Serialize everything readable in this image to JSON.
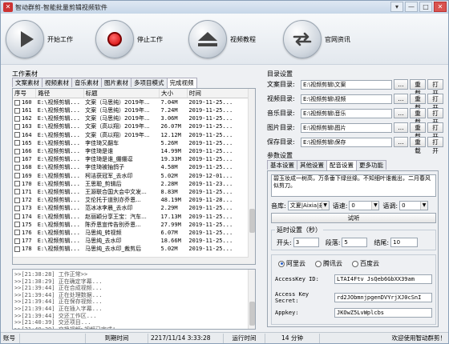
{
  "window": {
    "title": "智动群剪-智能批量剪辑视频软件",
    "controls": [
      "▾",
      "—",
      "□",
      "✕"
    ]
  },
  "toolbar": {
    "start_label": "开始工作",
    "stop_label": "停止工作",
    "tutorial_label": "视频教程",
    "website_label": "官网资讯"
  },
  "materials": {
    "section_title": "工作素材",
    "tabs": [
      "文案素材",
      "视频素材",
      "音乐素材",
      "图片素材",
      "多项目模式",
      "完成视频"
    ],
    "active_tab": 5,
    "columns": [
      "序号",
      "路径",
      "标题",
      "大小",
      "时间"
    ],
    "rows": [
      {
        "no": "160",
        "path": "E:\\视频剪辑...",
        "title": "文案（马思纯）2019年...",
        "size": "7.04M",
        "time": "2019-11-25..."
      },
      {
        "no": "161",
        "path": "E:\\视频剪辑...",
        "title": "文案（马思纯）2019年...",
        "size": "7.24M",
        "time": "2019-11-25..."
      },
      {
        "no": "162",
        "path": "E:\\视频剪辑...",
        "title": "文案（马思纯）2019年...",
        "size": "3.06M",
        "time": "2019-11-25..."
      },
      {
        "no": "163",
        "path": "E:\\视频剪辑...",
        "title": "文案（高以翔）2019年...",
        "size": "26.07M",
        "time": "2019-11-25..."
      },
      {
        "no": "164",
        "path": "E:\\视频剪辑...",
        "title": "文案（高以翔）2019年...",
        "size": "12.12M",
        "time": "2019-11-25..."
      },
      {
        "no": "165",
        "path": "E:\\视频剪辑...",
        "title": "李佳琦又翻车",
        "size": "5.26M",
        "time": "2019-11-25..."
      },
      {
        "no": "166",
        "path": "E:\\视频剪辑...",
        "title": "李佳琦是谁",
        "size": "14.99M",
        "time": "2019-11-25..."
      },
      {
        "no": "167",
        "path": "E:\\视频剪辑...",
        "title": "李佳琦是谁_绷绷逗",
        "size": "19.33M",
        "time": "2019-11-25..."
      },
      {
        "no": "168",
        "path": "E:\\视频剪辑...",
        "title": "李佳琦被抽鸽子",
        "size": "4.58M",
        "time": "2019-11-25..."
      },
      {
        "no": "169",
        "path": "E:\\视频剪辑...",
        "title": "柯洁获冠军_去水印",
        "size": "5.02M",
        "time": "2019-12-01..."
      },
      {
        "no": "170",
        "path": "E:\\视频剪辑...",
        "title": "王思聪_剪辑后",
        "size": "2.28M",
        "time": "2019-11-23..."
      },
      {
        "no": "171",
        "path": "E:\\视频剪辑...",
        "title": "王源联合国大会中文发...",
        "size": "8.83M",
        "time": "2019-11-25..."
      },
      {
        "no": "172",
        "path": "E:\\视频剪辑...",
        "title": "艾伦托于道别亦乔恩...",
        "size": "48.19M",
        "time": "2019-11-28..."
      },
      {
        "no": "173",
        "path": "E:\\视频剪辑...",
        "title": "范冰冰李晨_去水印",
        "size": "2.29M",
        "time": "2019-11-25..."
      },
      {
        "no": "174",
        "path": "E:\\视频剪辑...",
        "title": "赵丽颖分享王宝：汽车...",
        "size": "17.13M",
        "time": "2019-11-25..."
      },
      {
        "no": "175",
        "path": "E:\\视频剪辑...",
        "title": "陈乔恩宣传告别乔恩...",
        "size": "27.99M",
        "time": "2019-11-25..."
      },
      {
        "no": "176",
        "path": "E:\\视频剪辑...",
        "title": "马思纯_转视频",
        "size": "6.07M",
        "time": "2019-11-25..."
      },
      {
        "no": "177",
        "path": "E:\\视频剪辑...",
        "title": "马思纯_去水印",
        "size": "18.66M",
        "time": "2019-11-25..."
      },
      {
        "no": "178",
        "path": "E:\\视频剪辑...",
        "title": "马思纯_去水印_裁剪后",
        "size": "5.02M",
        "time": "2019-11-25..."
      }
    ]
  },
  "log": {
    "lines": [
      ">>[21:38:28] 工作正常>>",
      ">>[21:38:29] 正在确定字幕...",
      ">>[21:39:44] 正在合成视频...",
      ">>[21:39:44] 正在处理数据...",
      ">>[21:39:44] 正在保存视频...",
      ">>[21:39:44] 正在插入字幕...",
      ">>[21:39:44] 交还工作区...",
      ">>[21:40:39] 交还项目...",
      ">>[21:40:39] 交换视频>视频已完成!",
      ">>[21:40:39] 操作已完成!"
    ]
  },
  "dirs": {
    "section_title": "目录设置",
    "rows": [
      {
        "label": "文案目录:",
        "value": "E:\\视频剪辑\\文案"
      },
      {
        "label": "视频目录:",
        "value": "E:\\视频剪辑\\视频"
      },
      {
        "label": "音乐目录:",
        "value": "E:\\视频剪辑\\音乐"
      },
      {
        "label": "图片目录:",
        "value": "E:\\视频剪辑\\图片"
      },
      {
        "label": "保存目录:",
        "value": "E:\\视频剪辑\\保存"
      }
    ],
    "browse_label": "...",
    "reload_label": "重载",
    "open_label": "打开"
  },
  "params": {
    "section_title": "参数设置",
    "tabs": [
      "基本设置",
      "其他设置",
      "配音设置",
      "更多功能"
    ],
    "active_tab": 2,
    "sample_text": "碧玉妆成一树高，万条垂下绿丝绦。不知细叶谁裁出，二月春风似剪刀。",
    "voice_label": "音库:",
    "voice_value": "文夏|Aixia|亲",
    "speed_label": "语速:",
    "speed_value": "0",
    "tone_label": "语调:",
    "tone_value": "0",
    "listen_label": "试听",
    "delay_title": "延时设置（秒）",
    "start_label": "开头:",
    "start_value": "3",
    "segment_label": "段落:",
    "segment_value": "5",
    "end_label": "结尾:",
    "end_value": "10",
    "providers": [
      "阿里云",
      "腾讯云",
      "百度云"
    ],
    "selected_provider": 0,
    "access_id_label": "AccessKey ID:",
    "access_id_value": "LTAI4Ftv JsQeb6GbXX39am",
    "access_secret_label": "Access Key Secret:",
    "access_secret_value": "rd2JObmnjpgenDVYrjXJ0cSnI",
    "appkey_label": "Appkey:",
    "appkey_value": "JKOwZ5LvWplcbs"
  },
  "status": {
    "account_label": "账号",
    "account_value": "",
    "expire_label": "到期时间",
    "expire_value": "2217/11/14 3:33:28",
    "runtime_label": "运行时间",
    "runtime_value": "14 分钟",
    "welcome": "欢迎使用智动群剪！"
  }
}
